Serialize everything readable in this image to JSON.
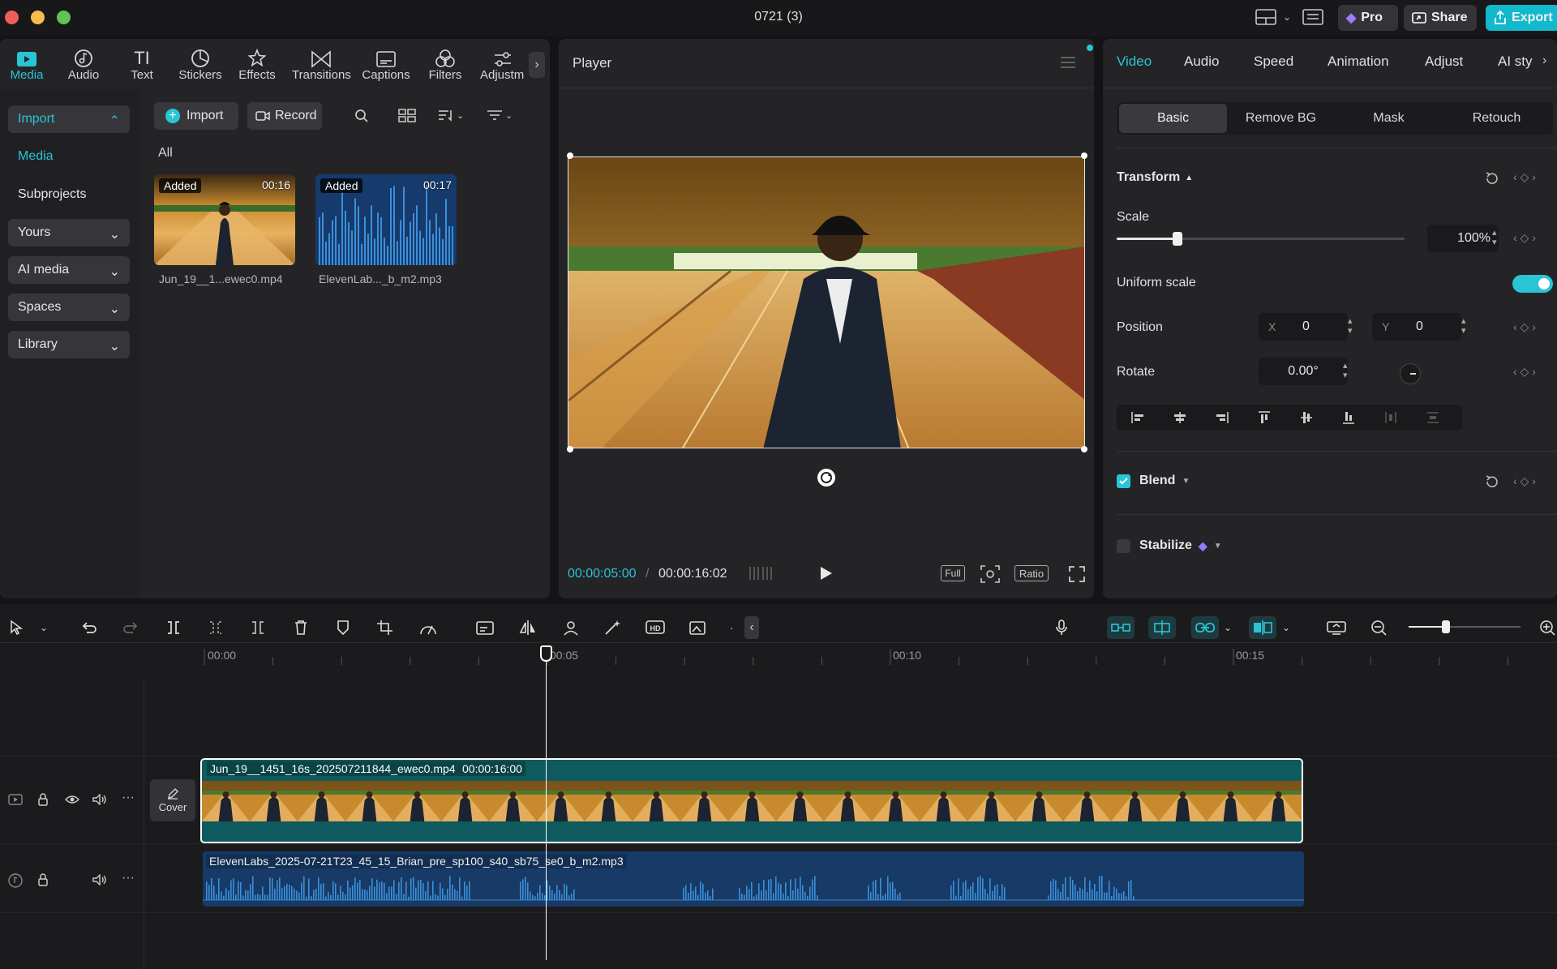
{
  "window": {
    "title": "0721 (3)"
  },
  "titlebar": {
    "pro_label": "Pro",
    "share_label": "Share",
    "export_label": "Export"
  },
  "toolbar": {
    "items": [
      {
        "label": "Media"
      },
      {
        "label": "Audio"
      },
      {
        "label": "Text"
      },
      {
        "label": "Stickers"
      },
      {
        "label": "Effects"
      },
      {
        "label": "Transitions"
      },
      {
        "label": "Captions"
      },
      {
        "label": "Filters"
      },
      {
        "label": "Adjustm"
      }
    ]
  },
  "sidebar": {
    "import": "Import",
    "media": "Media",
    "subprojects": "Subprojects",
    "yours": "Yours",
    "ai_media": "AI media",
    "spaces": "Spaces",
    "library": "Library"
  },
  "media_panel": {
    "import_button": "Import",
    "record_button": "Record",
    "filter_all": "All",
    "items": [
      {
        "badge": "Added",
        "duration": "00:16",
        "name": "Jun_19__1...ewec0.mp4"
      },
      {
        "badge": "Added",
        "duration": "00:17",
        "name": "ElevenLab..._b_m2.mp3"
      }
    ]
  },
  "player": {
    "title": "Player",
    "current_time": "00:00:05:00",
    "separator": "/",
    "total_time": "00:00:16:02",
    "full_label": "Full",
    "ratio_label": "Ratio"
  },
  "inspector": {
    "tabs": [
      "Video",
      "Audio",
      "Speed",
      "Animation",
      "Adjust",
      "AI sty"
    ],
    "subtabs": [
      "Basic",
      "Remove BG",
      "Mask",
      "Retouch"
    ],
    "transform_label": "Transform",
    "scale_label": "Scale",
    "scale_value": "100%",
    "scale_level": 0.21,
    "uniform_scale_label": "Uniform scale",
    "uniform_scale_on": true,
    "position_label": "Position",
    "pos_x_label": "X",
    "pos_x": "0",
    "pos_y_label": "Y",
    "pos_y": "0",
    "rotate_label": "Rotate",
    "rotate_value": "0.00°",
    "blend_label": "Blend",
    "blend_checked": true,
    "stabilize_label": "Stabilize",
    "stabilize_checked": false
  },
  "timeline": {
    "ruler": [
      "00:00",
      "00:05",
      "00:10",
      "00:15"
    ],
    "cover_label": "Cover",
    "video_clip": {
      "name": "Jun_19__1451_16s_202507211844_ewec0.mp4",
      "duration": "00:00:16:00"
    },
    "audio_clip": {
      "name": "ElevenLabs_2025-07-21T23_45_15_Brian_pre_sp100_s40_sb75_se0_b_m2.mp3"
    },
    "zoom_level": 0.33
  },
  "colors": {
    "accent": "#29c5d6",
    "video_clip": "#0f5a5e",
    "audio_clip": "#173a66",
    "export": "#12b8cc"
  }
}
